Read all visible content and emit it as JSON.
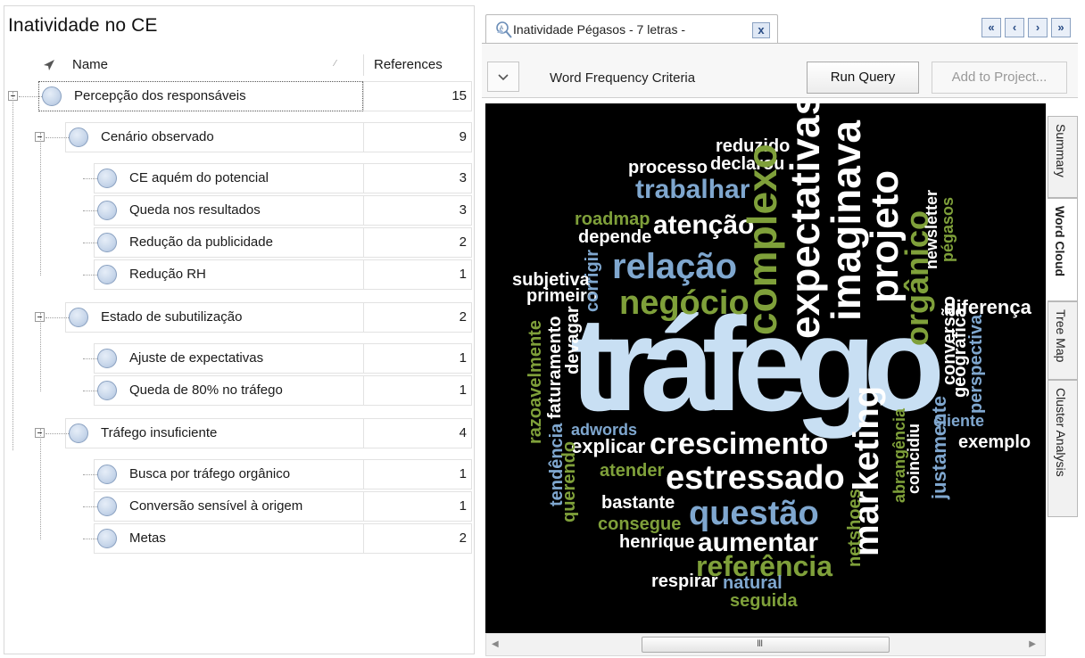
{
  "left_panel": {
    "title": "Inatividade no CE",
    "columns": {
      "name": "Name",
      "references": "References"
    },
    "rows": [
      {
        "label": "Percepção dos responsáveis",
        "count": "15"
      },
      {
        "label": "Cenário observado",
        "count": "9"
      },
      {
        "label": "CE aquém do potencial",
        "count": "3"
      },
      {
        "label": "Queda nos resultados",
        "count": "3"
      },
      {
        "label": "Redução da publicidade",
        "count": "2"
      },
      {
        "label": "Redução RH",
        "count": "1"
      },
      {
        "label": "Estado de subutilização",
        "count": "2"
      },
      {
        "label": "Ajuste de expectativas",
        "count": "1"
      },
      {
        "label": "Queda de 80% no tráfego",
        "count": "1"
      },
      {
        "label": "Tráfego insuficiente",
        "count": "4"
      },
      {
        "label": "Busca por  tráfego orgânico",
        "count": "1"
      },
      {
        "label": "Conversão sensível à origem",
        "count": "1"
      },
      {
        "label": "Metas",
        "count": "2"
      }
    ]
  },
  "right_panel": {
    "tab_title": "Inatividade Pégasos - 7 letras -",
    "tab_close": "x",
    "nav": {
      "first": "«",
      "prev": "‹",
      "next": "›",
      "last": "»"
    },
    "toolbar": {
      "toggle": "v",
      "criteria_label": "Word Frequency Criteria",
      "run_query": "Run Query",
      "add_to_project": "Add to Project..."
    },
    "side_tabs": [
      "Summary",
      "Word Cloud",
      "Tree Map",
      "Cluster Analysis"
    ],
    "scroll_grip": "III"
  },
  "colors": {
    "white": "#ffffff",
    "blue": "#7fa7cf",
    "green": "#7fa03a",
    "light_blue": "#c8dff3",
    "gray": "#cfcfcf"
  },
  "word_cloud": [
    {
      "w": "tráfego",
      "c": "light_blue"
    },
    {
      "w": "crescimento",
      "c": "white"
    },
    {
      "w": "estressado",
      "c": "white"
    },
    {
      "w": "questão",
      "c": "blue"
    },
    {
      "w": "aumentar",
      "c": "white"
    },
    {
      "w": "referência",
      "c": "green"
    },
    {
      "w": "negócio",
      "c": "green"
    },
    {
      "w": "relação",
      "c": "blue"
    },
    {
      "w": "atenção",
      "c": "white"
    },
    {
      "w": "trabalhar",
      "c": "blue"
    },
    {
      "w": "processo",
      "c": "white"
    },
    {
      "w": "declarou",
      "c": "white"
    },
    {
      "w": "reduzido",
      "c": "white"
    },
    {
      "w": "roadmap",
      "c": "green"
    },
    {
      "w": "depende",
      "c": "white"
    },
    {
      "w": "subjetiva",
      "c": "white"
    },
    {
      "w": "primeiro",
      "c": "white"
    },
    {
      "w": "corrigir",
      "c": "blue"
    },
    {
      "w": "complexo",
      "c": "green"
    },
    {
      "w": "expectativas",
      "c": "white"
    },
    {
      "w": "imaginava",
      "c": "white"
    },
    {
      "w": "projeto",
      "c": "white"
    },
    {
      "w": "orgânico",
      "c": "green"
    },
    {
      "w": "newsletter",
      "c": "white"
    },
    {
      "w": "pégasos",
      "c": "green"
    },
    {
      "w": "diferença",
      "c": "white"
    },
    {
      "w": "conversão",
      "c": "white"
    },
    {
      "w": "geográfica",
      "c": "white"
    },
    {
      "w": "perspectiva",
      "c": "blue"
    },
    {
      "w": "cliente",
      "c": "blue"
    },
    {
      "w": "exemplo",
      "c": "white"
    },
    {
      "w": "devagar",
      "c": "white"
    },
    {
      "w": "faturamento",
      "c": "white"
    },
    {
      "w": "razoavelmente",
      "c": "green"
    },
    {
      "w": "adwords",
      "c": "blue"
    },
    {
      "w": "explicar",
      "c": "white"
    },
    {
      "w": "atender",
      "c": "green"
    },
    {
      "w": "tendência",
      "c": "blue"
    },
    {
      "w": "querendo",
      "c": "green"
    },
    {
      "w": "bastante",
      "c": "white"
    },
    {
      "w": "consegue",
      "c": "green"
    },
    {
      "w": "henrique",
      "c": "white"
    },
    {
      "w": "marketing",
      "c": "white"
    },
    {
      "w": "abrangência",
      "c": "green"
    },
    {
      "w": "coincidiu",
      "c": "white"
    },
    {
      "w": "justamente",
      "c": "blue"
    },
    {
      "w": "netshoes",
      "c": "green"
    },
    {
      "w": "respirar",
      "c": "white"
    },
    {
      "w": "natural",
      "c": "blue"
    },
    {
      "w": "seguida",
      "c": "green"
    }
  ]
}
